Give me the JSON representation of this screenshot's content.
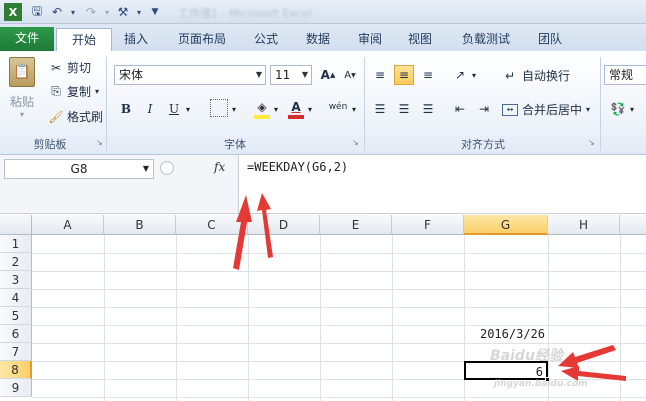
{
  "app": {
    "title_blurred": "工作簿1 - Microsoft Excel"
  },
  "tabs": [
    {
      "label": "文件"
    },
    {
      "label": "开始"
    },
    {
      "label": "插入"
    },
    {
      "label": "页面布局"
    },
    {
      "label": "公式"
    },
    {
      "label": "数据"
    },
    {
      "label": "审阅"
    },
    {
      "label": "视图"
    },
    {
      "label": "负载测试"
    },
    {
      "label": "团队"
    }
  ],
  "clipboard": {
    "paste": "粘贴",
    "cut": "剪切",
    "copy": "复制",
    "format_painter": "格式刷",
    "group": "剪贴板"
  },
  "font": {
    "name": "宋体",
    "size": "11",
    "bold": "B",
    "italic": "I",
    "underline": "U",
    "group": "字体"
  },
  "alignment": {
    "wrap": "自动换行",
    "merge": "合并后居中",
    "group": "对齐方式"
  },
  "number": {
    "format": "常规"
  },
  "formula_bar": {
    "name_box": "G8",
    "fx": "fx",
    "formula": "=WEEKDAY(G6,2)"
  },
  "columns": [
    "A",
    "B",
    "C",
    "D",
    "E",
    "F",
    "G",
    "H"
  ],
  "rows": [
    "1",
    "2",
    "3",
    "4",
    "5",
    "6",
    "7",
    "8",
    "9"
  ],
  "cells": {
    "G6": "2016/3/26",
    "G8": "6"
  },
  "watermark": {
    "line1": "Baidu经验",
    "line2": "jingyan.baidu.com"
  },
  "colors": {
    "file_tab": "#1d7a36",
    "selection_header": "#f9cf6a",
    "arrow": "#e53935"
  }
}
